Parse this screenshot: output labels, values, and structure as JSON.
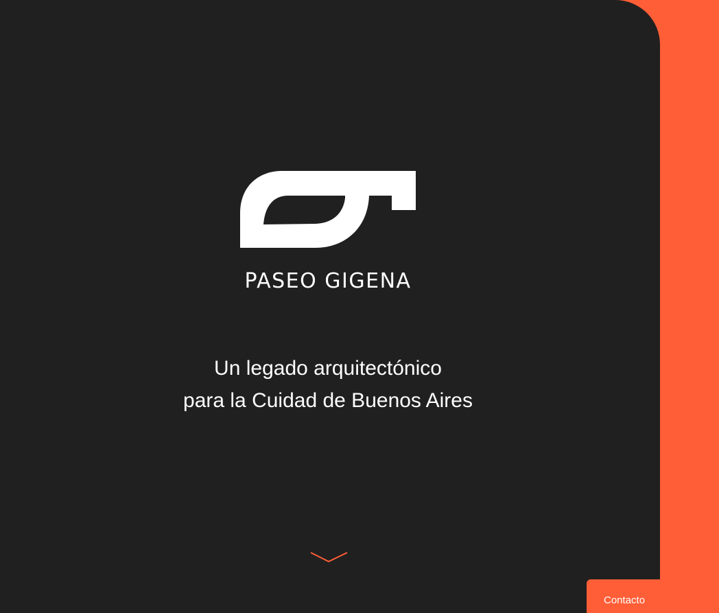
{
  "hero": {
    "logo_icon": "paseo-gigena-g-mark",
    "brand_name": "PASEO GIGENA",
    "tagline_line1": "Un legado arquitectónico",
    "tagline_line2": "para la Cuidad de Buenos Aires",
    "scroll_icon": "chevron-down-icon"
  },
  "contact": {
    "label": "Contacto"
  },
  "colors": {
    "background_dark": "#202020",
    "accent_orange": "#ff5e37",
    "text": "#ffffff"
  }
}
